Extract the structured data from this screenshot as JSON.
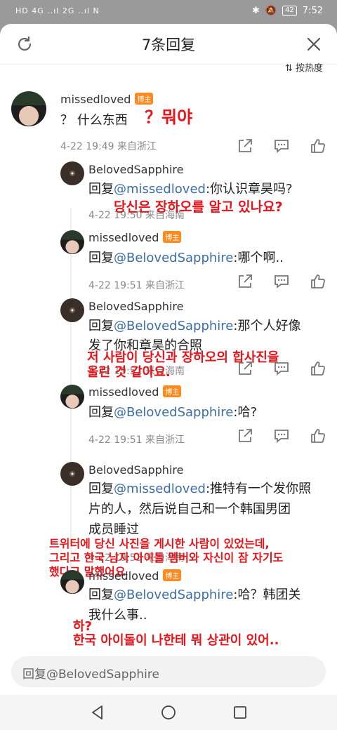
{
  "status_bar": {
    "left": "HD 4G ..ıl 2G ..ıl N",
    "time": "7:52",
    "battery": "42"
  },
  "header": {
    "title": "7条回复"
  },
  "sort_label": "按热度",
  "main_comment": {
    "user": "missedloved",
    "badge": "博主",
    "text": "？ 什么东西",
    "meta": "4-22 19:49  来自浙江",
    "overlay": "？뭐야"
  },
  "replies": [
    {
      "user": "BelovedSapphire",
      "prefix": "回复",
      "mention": "@missedloved",
      "text": ":你认识章昊吗?",
      "meta": "4-22 19:50  来自海南",
      "overlay": "당신은 장하오를 알고 있나요?"
    },
    {
      "user": "missedloved",
      "badge": "博主",
      "prefix": "回复",
      "mention": "@BelovedSapphire",
      "text": ":哪个啊..",
      "meta": "4-22 19:51  来自浙江"
    },
    {
      "user": "BelovedSapphire",
      "prefix": "回复",
      "mention": "@BelovedSapphire",
      "text": ":那个人好像",
      "text2": "发了你和章昊的合照",
      "meta": "4-22 19:51  来自海南",
      "overlay1": "저 사람이 당신과 장하오의 합사진을",
      "overlay2": "올린 것 같아요."
    },
    {
      "user": "missedloved",
      "badge": "博主",
      "prefix": "回复",
      "mention": "@BelovedSapphire",
      "text": ":哈?",
      "meta": "4-22 19:51  来自浙江"
    },
    {
      "user": "BelovedSapphire",
      "prefix": "回复",
      "mention": "@missedloved",
      "text": ":推特有一个发你照",
      "text2": "片的人，然后说自己和一个韩国男团",
      "text3": "成员睡过",
      "meta": "4-22 19:53  来自海南",
      "overlay1": "트위터에 당신 사진을 게시한 사람이 있었는데,",
      "overlay2": "그리고 한국 남자 아이돌 멤버와 자신이 잠 자기도",
      "overlay3": "했다고 말했어요"
    },
    {
      "user": "missedloved",
      "badge": "博主",
      "prefix": "回复",
      "mention": "@BelovedSapphire",
      "text": ":哈？韩团关",
      "text2": "我什么事..",
      "meta": "4-22 19:54  来自浙江",
      "overlay1": "하?",
      "overlay2": "한국 아이돌이 나한테 뭐 상관이 있어.."
    }
  ],
  "reply_input": {
    "placeholder": "回复@BelovedSapphire"
  },
  "colors": {
    "mention": "#3c6ea5",
    "badge": "#ff8a1f",
    "overlay_text": "#e8141a"
  }
}
